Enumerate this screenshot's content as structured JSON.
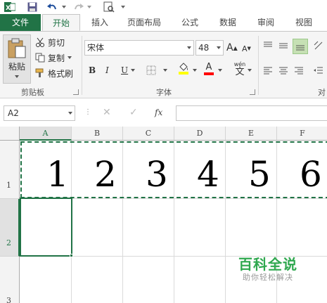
{
  "qat": {
    "icons": [
      "excel-logo-icon",
      "save-icon",
      "undo-icon",
      "redo-icon",
      "print-preview-icon"
    ]
  },
  "tabs": [
    "文件",
    "开始",
    "插入",
    "页面布局",
    "公式",
    "数据",
    "审阅",
    "视图"
  ],
  "ribbon": {
    "clipboard": {
      "paste": "粘贴",
      "cut": "剪切",
      "copy": "复制",
      "format_painter": "格式刷",
      "group_label": "剪贴板"
    },
    "font": {
      "font_name": "宋体",
      "font_size": "48",
      "bold": "B",
      "italic": "I",
      "underline": "U",
      "phonetic": "wén",
      "phonetic_char": "文",
      "group_label": "字体",
      "fill_color": "#ffff00",
      "font_color": "#ff0000"
    },
    "alignment": {
      "group_label_partial": "对"
    }
  },
  "formula_bar": {
    "name_box": "A2",
    "fx": "fx",
    "formula": ""
  },
  "grid": {
    "columns": [
      "A",
      "B",
      "C",
      "D",
      "E",
      "F"
    ],
    "active_column": "A",
    "rows": [
      "1",
      "2",
      "3"
    ],
    "active_row": "2",
    "row1_values": [
      "1",
      "2",
      "3",
      "4",
      "5",
      "6"
    ]
  },
  "watermark": {
    "title": "百科全说",
    "subtitle": "助你轻松解决"
  },
  "colors": {
    "accent": "#217346",
    "ribbon_bg": "#f5f5f5"
  }
}
